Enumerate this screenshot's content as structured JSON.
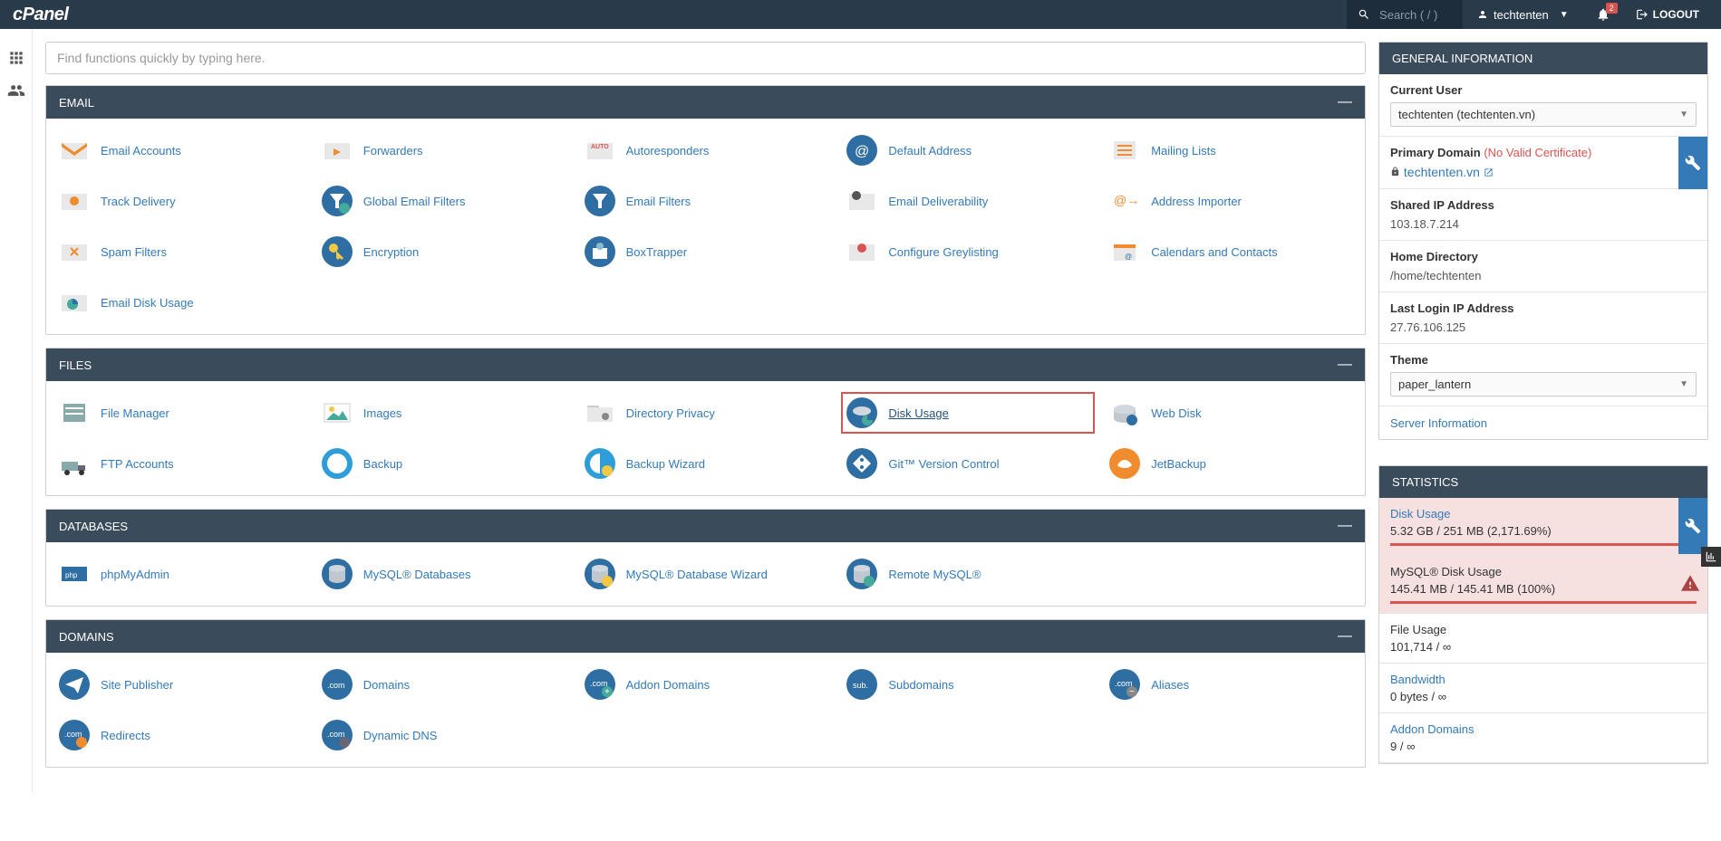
{
  "header": {
    "logo": "cPanel",
    "search_placeholder": "Search ( / )",
    "username": "techtenten",
    "notification_count": "2",
    "logout": "LOGOUT"
  },
  "quick_search_placeholder": "Find functions quickly by typing here.",
  "groups": [
    {
      "title": "EMAIL",
      "items": [
        {
          "label": "Email Accounts",
          "icon": "envelope-user"
        },
        {
          "label": "Forwarders",
          "icon": "envelope-arrow"
        },
        {
          "label": "Autoresponders",
          "icon": "envelope-auto"
        },
        {
          "label": "Default Address",
          "icon": "at-blue"
        },
        {
          "label": "Mailing Lists",
          "icon": "list"
        },
        {
          "label": "Track Delivery",
          "icon": "envelope-pin"
        },
        {
          "label": "Global Email Filters",
          "icon": "funnel-globe"
        },
        {
          "label": "Email Filters",
          "icon": "funnel"
        },
        {
          "label": "Email Deliverability",
          "icon": "envelope-check"
        },
        {
          "label": "Address Importer",
          "icon": "at-import"
        },
        {
          "label": "Spam Filters",
          "icon": "envelope-spam"
        },
        {
          "label": "Encryption",
          "icon": "key"
        },
        {
          "label": "BoxTrapper",
          "icon": "box-trap"
        },
        {
          "label": "Configure Greylisting",
          "icon": "envelope-grey"
        },
        {
          "label": "Calendars and Contacts",
          "icon": "calendar"
        },
        {
          "label": "Email Disk Usage",
          "icon": "envelope-pie"
        }
      ]
    },
    {
      "title": "FILES",
      "items": [
        {
          "label": "File Manager",
          "icon": "drawer"
        },
        {
          "label": "Images",
          "icon": "image"
        },
        {
          "label": "Directory Privacy",
          "icon": "folder-lock"
        },
        {
          "label": "Disk Usage",
          "icon": "disk-pie",
          "highlighted": true
        },
        {
          "label": "Web Disk",
          "icon": "disk-globe"
        },
        {
          "label": "FTP Accounts",
          "icon": "truck"
        },
        {
          "label": "Backup",
          "icon": "backup"
        },
        {
          "label": "Backup Wizard",
          "icon": "backup-wizard"
        },
        {
          "label": "Git™ Version Control",
          "icon": "git"
        },
        {
          "label": "JetBackup",
          "icon": "jet"
        }
      ]
    },
    {
      "title": "DATABASES",
      "items": [
        {
          "label": "phpMyAdmin",
          "icon": "pma"
        },
        {
          "label": "MySQL® Databases",
          "icon": "db"
        },
        {
          "label": "MySQL® Database Wizard",
          "icon": "db-wizard"
        },
        {
          "label": "Remote MySQL®",
          "icon": "db-remote"
        }
      ]
    },
    {
      "title": "DOMAINS",
      "items": [
        {
          "label": "Site Publisher",
          "icon": "paper-plane"
        },
        {
          "label": "Domains",
          "icon": "dotcom"
        },
        {
          "label": "Addon Domains",
          "icon": "dotcom-plus"
        },
        {
          "label": "Subdomains",
          "icon": "sub"
        },
        {
          "label": "Aliases",
          "icon": "dotcom-minus"
        },
        {
          "label": "Redirects",
          "icon": "dotcom-redirect"
        },
        {
          "label": "Dynamic DNS",
          "icon": "dotcom-dns"
        }
      ]
    }
  ],
  "general_info": {
    "title": "GENERAL INFORMATION",
    "current_user_label": "Current User",
    "current_user_value": "techtenten (techtenten.vn)",
    "primary_domain_label": "Primary Domain",
    "no_cert": "(No Valid Certificate)",
    "domain": "techtenten.vn",
    "shared_ip_label": "Shared IP Address",
    "shared_ip_value": "103.18.7.214",
    "home_dir_label": "Home Directory",
    "home_dir_value": "/home/techtenten",
    "last_login_label": "Last Login IP Address",
    "last_login_value": "27.76.106.125",
    "theme_label": "Theme",
    "theme_value": "paper_lantern",
    "server_info": "Server Information"
  },
  "statistics": {
    "title": "STATISTICS",
    "rows": [
      {
        "label": "Disk Usage",
        "value": "5.32 GB / 251 MB   (2,171.69%)",
        "alert": true,
        "link": true,
        "progress": 100,
        "wrench": true
      },
      {
        "label": "MySQL® Disk Usage",
        "value": "145.41 MB / 145.41 MB   (100%)",
        "alert": true,
        "link": false,
        "progress": 100,
        "warn": true
      },
      {
        "label": "File Usage",
        "value": "101,714 / ∞",
        "link": false
      },
      {
        "label": "Bandwidth",
        "value": "0 bytes / ∞",
        "link": true
      },
      {
        "label": "Addon Domains",
        "value": "9 / ∞",
        "link": true
      }
    ]
  }
}
